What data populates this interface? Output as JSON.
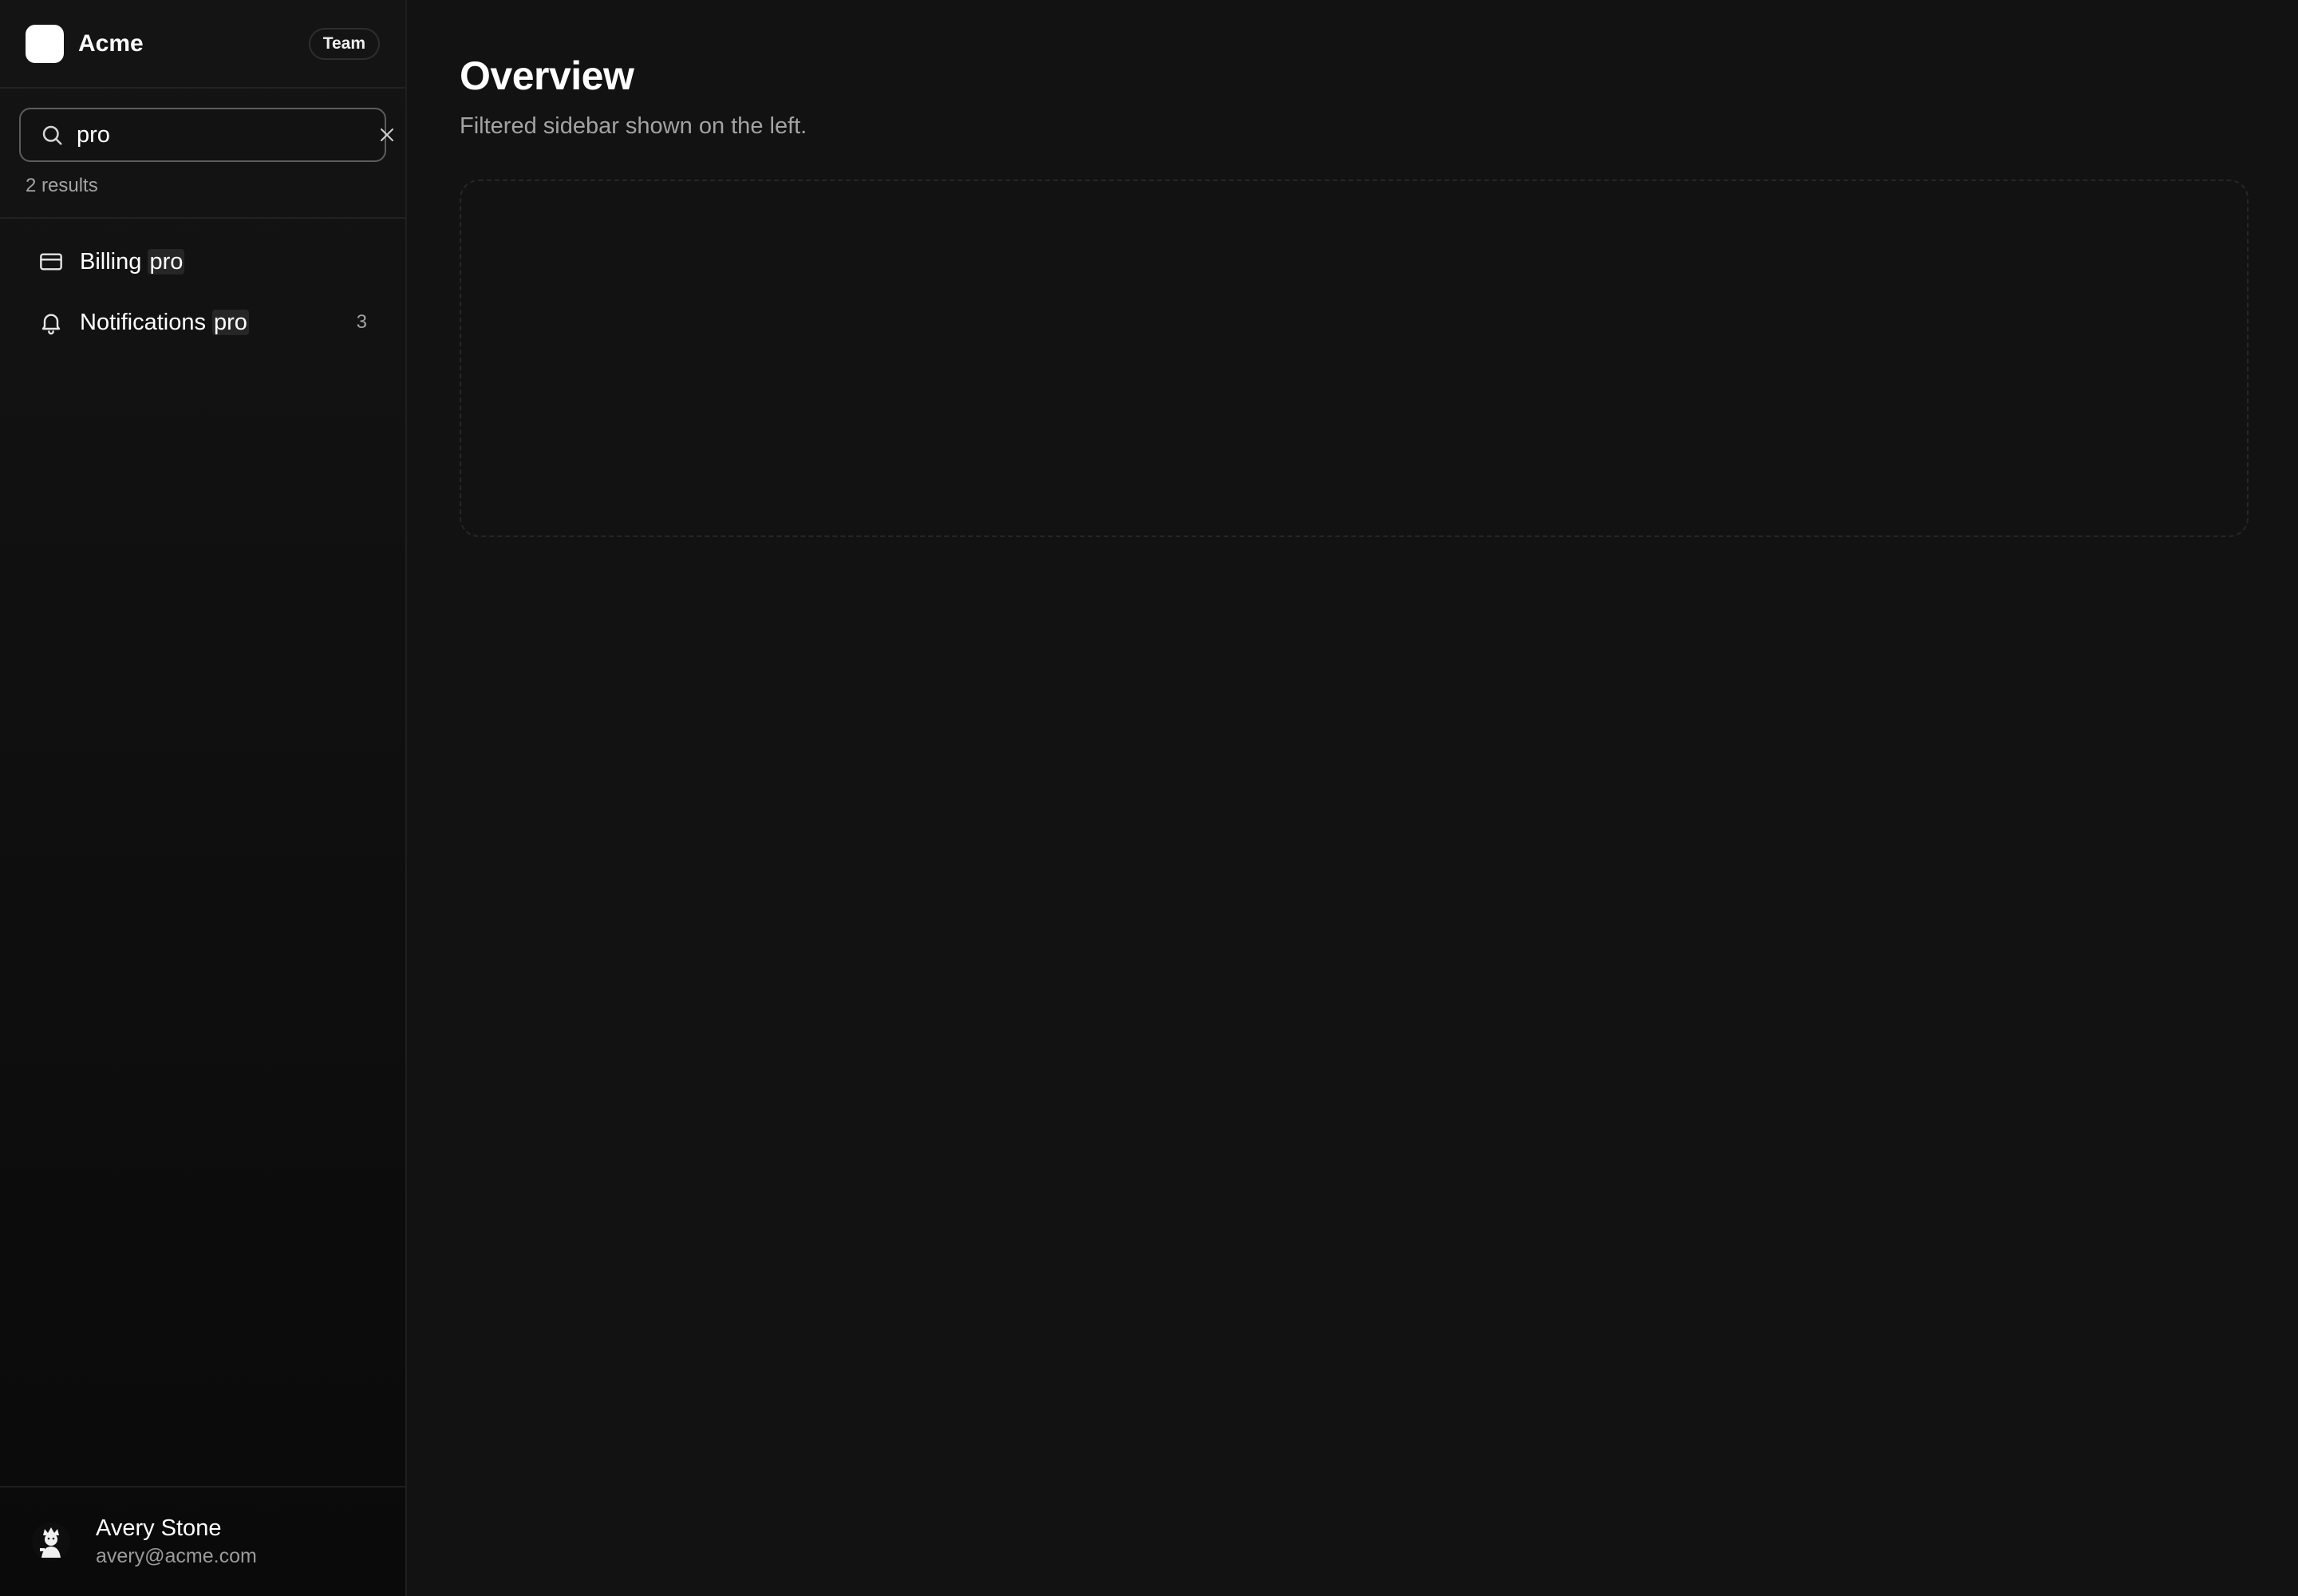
{
  "sidebar": {
    "brand": "Acme",
    "team_badge": "Team",
    "search": {
      "value": "pro",
      "placeholder": "Search",
      "results_label": "2 results"
    },
    "items": [
      {
        "label_prefix": "Billing ",
        "label_match": "pro",
        "icon": "credit-card-icon",
        "count": ""
      },
      {
        "label_prefix": "Notifications ",
        "label_match": "pro",
        "icon": "bell-icon",
        "count": "3"
      }
    ],
    "user": {
      "name": "Avery Stone",
      "email": "avery@acme.com"
    }
  },
  "main": {
    "title": "Overview",
    "subtitle": "Filtered sidebar shown on the left."
  },
  "colors": {
    "background": "#121212",
    "sidebar": "#0a0a0a",
    "highlight": "#262626"
  }
}
